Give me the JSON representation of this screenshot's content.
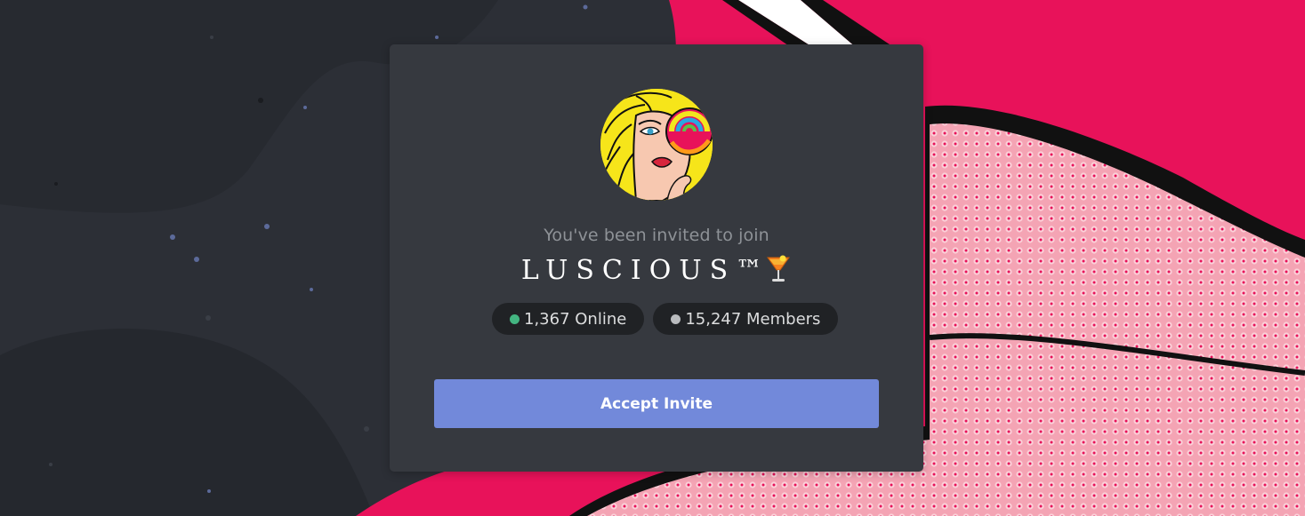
{
  "colors": {
    "background_dark": "#2c2f36",
    "card": "#36393f",
    "pill": "#202225",
    "online_dot": "#43b581",
    "members_dot": "#b9bbbe",
    "accent_button": "#7289da",
    "art_pink": "#e8125a"
  },
  "invite": {
    "subtitle": "You've been invited to join",
    "server_name": "LUSCIOUS™",
    "server_icon": "cocktail-emoji",
    "avatar": "server-avatar-popart-woman-lollipop"
  },
  "stats": {
    "online_label": "1,367 Online",
    "members_label": "15,247 Members"
  },
  "actions": {
    "accept_label": "Accept Invite"
  }
}
